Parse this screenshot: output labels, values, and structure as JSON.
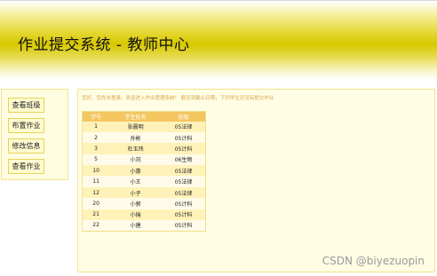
{
  "header": {
    "title": "作业提交系统 - 教师中心"
  },
  "sidebar": {
    "items": [
      {
        "label": "查看班级"
      },
      {
        "label": "布置作业"
      },
      {
        "label": "修改信息"
      },
      {
        "label": "查看作业"
      }
    ]
  },
  "main": {
    "welcome_text": "您好，您尚未登录。欢迎进入作业管理系统！ 截至到截止日期，下列学生还没有提交作业",
    "table": {
      "headers": [
        "学号",
        "学生姓名",
        "班级"
      ],
      "rows": [
        [
          "1",
          "张晨明",
          "05法律"
        ],
        [
          "2",
          "孙彬",
          "05计科"
        ],
        [
          "3",
          "杜玉玮",
          "05计科"
        ],
        [
          "5",
          "小刘",
          "06生物"
        ],
        [
          "10",
          "小惠",
          "05法律"
        ],
        [
          "11",
          "小王",
          "05法律"
        ],
        [
          "12",
          "小子",
          "05法律"
        ],
        [
          "20",
          "小郭",
          "05计科"
        ],
        [
          "21",
          "小揣",
          "05计科"
        ],
        [
          "22",
          "小唐",
          "05计科"
        ]
      ]
    }
  },
  "watermark": "CSDN @biyezuopin"
}
